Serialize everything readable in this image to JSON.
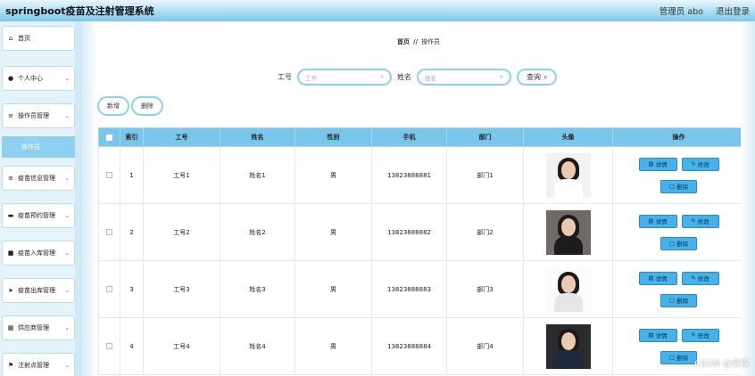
{
  "app": {
    "title": "springboot疫苗及注射管理系统",
    "user": "管理员 abo",
    "logout": "退出登录"
  },
  "sidebar": {
    "items": [
      {
        "label": "首页",
        "icon": "home-icon",
        "glyph": "⌂",
        "chevron": false
      },
      {
        "label": "个人中心",
        "icon": "user-icon",
        "glyph": "●",
        "chevron": true
      },
      {
        "label": "操作员管理",
        "icon": "list-icon",
        "glyph": "≡",
        "chevron": true
      },
      {
        "label": "疫苗信息管理",
        "icon": "list-icon",
        "glyph": "≡",
        "chevron": true
      },
      {
        "label": "疫苗预约管理",
        "icon": "briefcase-icon",
        "glyph": "▬",
        "chevron": true
      },
      {
        "label": "疫苗入库管理",
        "icon": "database-icon",
        "glyph": "■",
        "chevron": true
      },
      {
        "label": "疫苗出库管理",
        "icon": "send-icon",
        "glyph": "➤",
        "chevron": true
      },
      {
        "label": "供应商管理",
        "icon": "grid-icon",
        "glyph": "▦",
        "chevron": true
      },
      {
        "label": "注射点管理",
        "icon": "flag-icon",
        "glyph": "⚑",
        "chevron": true
      }
    ],
    "sub_item": "操作员"
  },
  "breadcrumb": {
    "home": "首页",
    "sep": "//",
    "current": "操作员"
  },
  "search": {
    "label1": "工号",
    "placeholder1": "工号",
    "label2": "姓名",
    "placeholder2": "姓名",
    "query": "查询"
  },
  "actions": {
    "add": "新增",
    "delete": "删除"
  },
  "table": {
    "headers": [
      "",
      "索引",
      "工号",
      "姓名",
      "性别",
      "手机",
      "部门",
      "头像",
      "操作"
    ],
    "rows": [
      {
        "index": "1",
        "id": "工号1",
        "name": "姓名1",
        "gender": "男",
        "phone": "13823888881",
        "dept": "部门1",
        "photo": {
          "bg": "#f2f2f2",
          "body": "#ffffff"
        }
      },
      {
        "index": "2",
        "id": "工号2",
        "name": "姓名2",
        "gender": "男",
        "phone": "13823888882",
        "dept": "部门2",
        "photo": {
          "bg": "#6f6a68",
          "body": "#1c1c1c"
        }
      },
      {
        "index": "3",
        "id": "工号3",
        "name": "姓名3",
        "gender": "男",
        "phone": "13823888883",
        "dept": "部门3",
        "photo": {
          "bg": "#fbfbfb",
          "body": "#e6e6e6"
        }
      },
      {
        "index": "4",
        "id": "工号4",
        "name": "姓名4",
        "gender": "男",
        "phone": "13823888884",
        "dept": "部门4",
        "photo": {
          "bg": "#2a2b2f",
          "body": "#1e2a3a"
        }
      }
    ],
    "ops": {
      "detail": "详情",
      "edit": "修改",
      "delete": "删除"
    }
  },
  "watermark": "CSDN @佳倫",
  "colors": {
    "accent": "#79c6ea",
    "button": "#45b3ea"
  }
}
